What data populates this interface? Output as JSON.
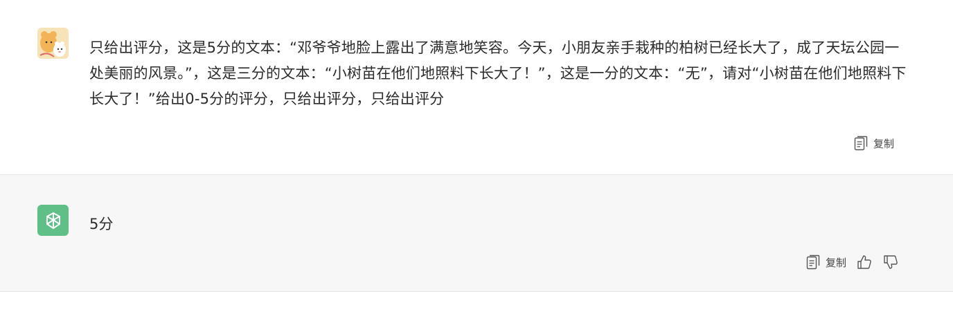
{
  "user_message": {
    "text": "只给出评分，这是5分的文本：“邓爷爷地脸上露出了满意地笑容。今天，小朋友亲手栽种的柏树已经长大了，成了天坛公园一处美丽的风景。”，这是三分的文本：“小树苗在他们地照料下长大了！”，这是一分的文本：“无”，请对“小树苗在他们地照料下长大了！”给出0-5分的评分，只给出评分，只给出评分",
    "copy_label": "复制",
    "avatar_icon": "cartoon-avatar-icon"
  },
  "assistant_message": {
    "text": "5分",
    "copy_label": "复制",
    "avatar_icon": "openai-logo-icon",
    "avatar_color": "#19c37d"
  },
  "colors": {
    "assistant_bg": "#f7f7f8",
    "user_bg": "#ffffff",
    "text": "#2b2b2b"
  }
}
